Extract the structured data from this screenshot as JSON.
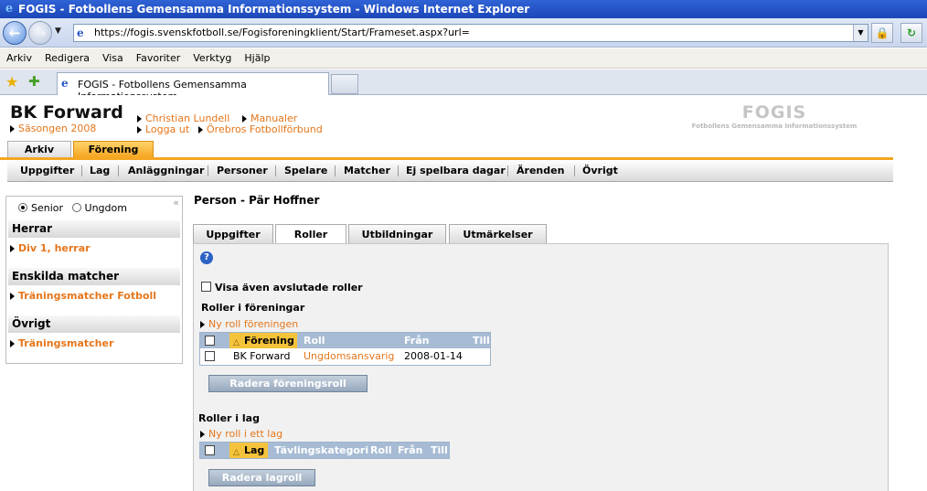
{
  "browser": {
    "window_title": "FOGIS - Fotbollens Gemensamma Informationssystem - Windows Internet Explorer",
    "url": "https://fogis.svenskfotboll.se/Fogisforeningklient/Start/Frameset.aspx?url=",
    "menu": [
      "Arkiv",
      "Redigera",
      "Visa",
      "Favoriter",
      "Verktyg",
      "Hjälp"
    ],
    "tab_title": "FOGIS - Fotbollens Gemensamma Informationssystem"
  },
  "header": {
    "club": "BK Forward",
    "season": "Säsongen 2008",
    "user": "Christian Lundell",
    "manual": "Manualer",
    "logout": "Logga ut",
    "district": "Örebros Fotbollförbund",
    "logo_big": "FOGIS",
    "logo_small": "Fotbollens Gemensamma Informationssystem"
  },
  "main_tabs": [
    "Arkiv",
    "Förening"
  ],
  "subnav": [
    "Uppgifter",
    "Lag",
    "Anläggningar",
    "Personer",
    "Spelare",
    "Matcher",
    "Ej spelbara dagar",
    "Ärenden",
    "Övrigt"
  ],
  "sidebar": {
    "collapse": "«",
    "radio_senior": "Senior",
    "radio_youth": "Ungdom",
    "sections": [
      {
        "title": "Herrar",
        "link": "Div 1, herrar"
      },
      {
        "title": "Enskilda matcher",
        "link": "Träningsmatcher Fotboll"
      },
      {
        "title": "Övrigt",
        "link": "Träningsmatcher"
      }
    ]
  },
  "content": {
    "title": "Person - Pär Hoffner",
    "tabs": [
      "Uppgifter",
      "Roller",
      "Utbildningar",
      "Utmärkelser"
    ],
    "help": "?",
    "show_ended": "Visa även avslutade roller",
    "club_roles": {
      "title": "Roller i föreningar",
      "add": "Ny roll föreningen",
      "columns": [
        "Förening",
        "Roll",
        "Från",
        "Till"
      ],
      "rows": [
        {
          "club": "BK Forward",
          "role": "Ungdomsansvarig",
          "from": "2008-01-14",
          "to": ""
        }
      ],
      "delete": "Radera föreningsroll"
    },
    "team_roles": {
      "title": "Roller i lag",
      "add": "Ny roll i ett lag",
      "columns": [
        "Lag",
        "Tävlingskategori",
        "Roll",
        "Från",
        "Till"
      ],
      "delete": "Radera lagroll"
    }
  },
  "colors": {
    "accent": "#f5a623",
    "link": "#e5761b",
    "grid_header": "#a7bcd4"
  }
}
